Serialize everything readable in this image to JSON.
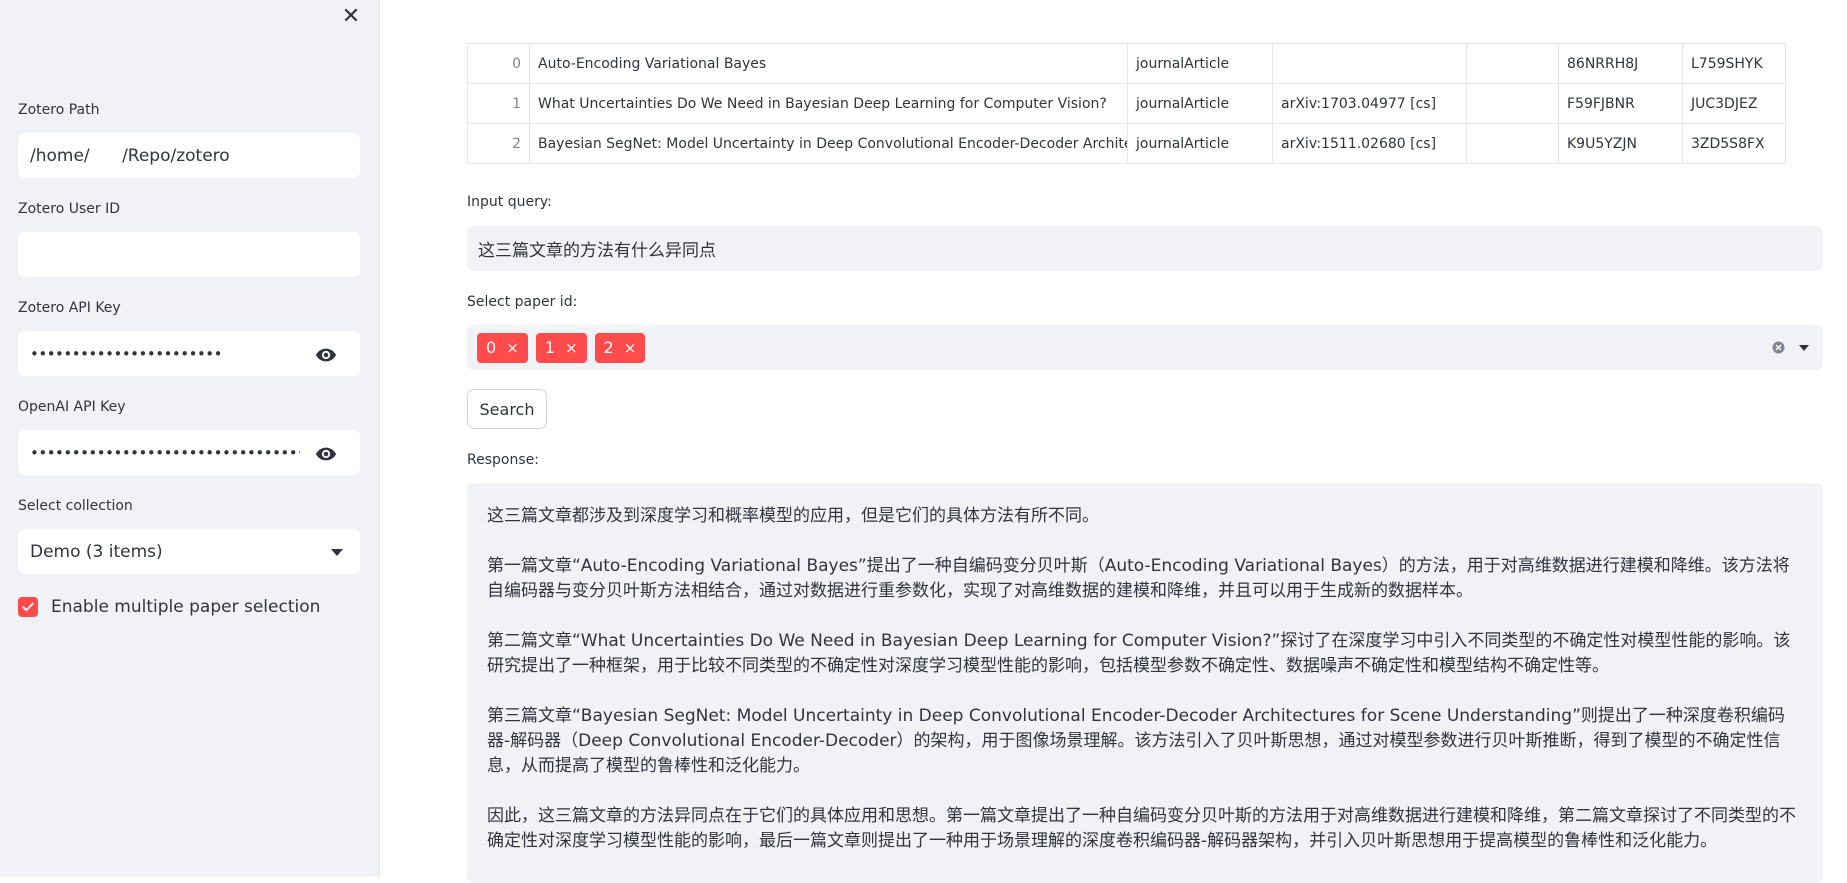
{
  "sidebar": {
    "close_icon": "close-icon",
    "zotero_path_label": "Zotero Path",
    "zotero_path_value": "/home/      /Repo/zotero",
    "user_id_label": "Zotero User ID",
    "user_id_value": "",
    "api_key_label": "Zotero API Key",
    "api_key_value": "•••••••••••••••••••••••",
    "openai_key_label": "OpenAI API Key",
    "openai_key_value": "•••••••••••••••••••••••••••••••••••••••••••••••••••",
    "collection_label": "Select collection",
    "collection_value": "Demo (3 items)",
    "multi_select_label": "Enable multiple paper selection",
    "multi_select_checked": true
  },
  "table": {
    "rows": [
      {
        "idx": "0",
        "title": "Auto-Encoding Variational Bayes",
        "type": "journalArticle",
        "extra": "",
        "empty": "",
        "key1": "86NRRH8J",
        "key2": "L759SHYK"
      },
      {
        "idx": "1",
        "title": "What Uncertainties Do We Need in Bayesian Deep Learning for Computer Vision?",
        "type": "journalArticle",
        "extra": "arXiv:1703.04977 [cs]",
        "empty": "",
        "key1": "F59FJBNR",
        "key2": "JUC3DJEZ"
      },
      {
        "idx": "2",
        "title": "Bayesian SegNet: Model Uncertainty in Deep Convolutional Encoder-Decoder Architectures for Scene Understanding",
        "type": "journalArticle",
        "extra": "arXiv:1511.02680 [cs]",
        "empty": "",
        "key1": "K9U5YZJN",
        "key2": "3ZD5S8FX"
      }
    ]
  },
  "query": {
    "label": "Input query:",
    "value": "这三篇文章的方法有什么异同点"
  },
  "paper_select": {
    "label": "Select paper id:",
    "tags": [
      "0",
      "1",
      "2"
    ],
    "remove_glyph": "×"
  },
  "search": {
    "label": "Search"
  },
  "response": {
    "label": "Response:",
    "paragraphs": [
      "这三篇文章都涉及到深度学习和概率模型的应用，但是它们的具体方法有所不同。",
      "第一篇文章“Auto-Encoding Variational Bayes”提出了一种自编码变分贝叶斯（Auto-Encoding Variational Bayes）的方法，用于对高维数据进行建模和降维。该方法将自编码器与变分贝叶斯方法相结合，通过对数据进行重参数化，实现了对高维数据的建模和降维，并且可以用于生成新的数据样本。",
      "第二篇文章“What Uncertainties Do We Need in Bayesian Deep Learning for Computer Vision?”探讨了在深度学习中引入不同类型的不确定性对模型性能的影响。该研究提出了一种框架，用于比较不同类型的不确定性对深度学习模型性能的影响，包括模型参数不确定性、数据噪声不确定性和模型结构不确定性等。",
      "第三篇文章“Bayesian SegNet: Model Uncertainty in Deep Convolutional Encoder-Decoder Architectures for Scene Understanding”则提出了一种深度卷积编码器-解码器（Deep Convolutional Encoder-Decoder）的架构，用于图像场景理解。该方法引入了贝叶斯思想，通过对模型参数进行贝叶斯推断，得到了模型的不确定性信息，从而提高了模型的鲁棒性和泛化能力。",
      "因此，这三篇文章的方法异同点在于它们的具体应用和思想。第一篇文章提出了一种自编码变分贝叶斯的方法用于对高维数据进行建模和降维，第二篇文章探讨了不同类型的不确定性对深度学习模型性能的影响，最后一篇文章则提出了一种用于场景理解的深度卷积编码器-解码器架构，并引入贝叶斯思想用于提高模型的鲁棒性和泛化能力。"
    ]
  },
  "colors": {
    "accent": "#ff4b4b",
    "sidebar_bg": "#f0f2f6",
    "text": "#31333f"
  }
}
